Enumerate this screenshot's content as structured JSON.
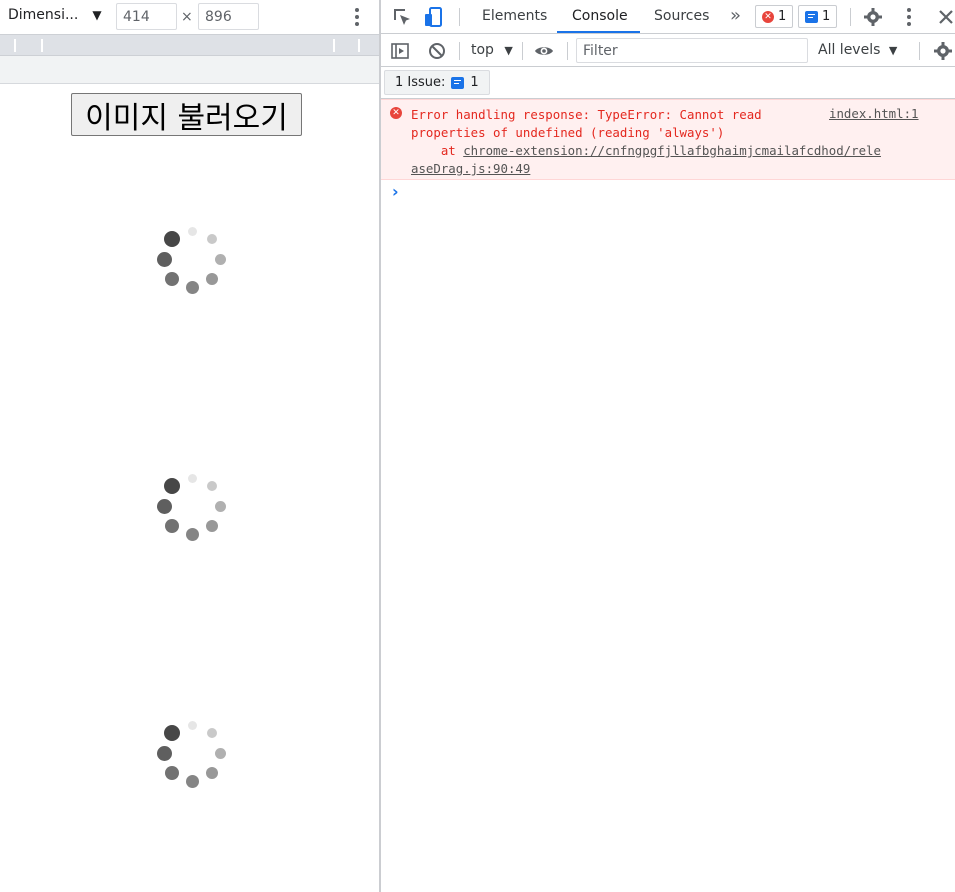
{
  "device_toolbar": {
    "device_label": "Dimensi...",
    "width_value": "414",
    "times_sign": "×",
    "height_value": "896"
  },
  "page": {
    "load_button_label": "이미지 불러오기",
    "spinner_count": 3
  },
  "devtools": {
    "tabs": [
      "Elements",
      "Console",
      "Sources"
    ],
    "active_tab": "Console",
    "error_count": "1",
    "message_count": "1",
    "console": {
      "context": "top",
      "filter_placeholder": "Filter",
      "levels": "All levels",
      "issues_label": "1 Issue:",
      "issues_count": "1",
      "error": {
        "line1": "Error handling response: TypeError: Cannot read",
        "line2": "properties of undefined (reading 'always')",
        "line3_prefix": "    at ",
        "link_part1": "chrome-extension://cnfngpgfjllafbghaimjcmailafcdhod/rele",
        "link_part2": "aseDrag.js:90:49",
        "location": "index.html:1"
      }
    }
  },
  "colors": {
    "accent": "#1a73e8",
    "error_text": "#e4281f",
    "error_bg": "#fff0f0"
  }
}
